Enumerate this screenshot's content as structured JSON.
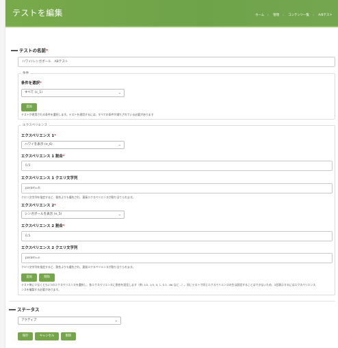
{
  "header": {
    "title": "テストを編集",
    "breadcrumbs": [
      "ホーム",
      "管理",
      "コンテンツ一覧",
      "A/Bテスト"
    ],
    "separator": "›",
    "color": "#74a64c"
  },
  "name_section": {
    "label": "テストの名前",
    "required": "*",
    "value": "ハワイ/シンガポール　ABテスト"
  },
  "conditions": {
    "legend": "条件",
    "select_label": "条件を選択",
    "required": "*",
    "select_value": "すべて (c_1)",
    "add_button": "追加",
    "help": "テストが適用される条件を選択します。テストを適用するには、すべての条件が満たされている必要があります"
  },
  "experiences": {
    "legend": "エクスペリエンス",
    "items": [
      {
        "label": "エクスペリエンス 1",
        "required": "*",
        "select_value": "ハワイを表示 (e_6)",
        "ratio_label": "エクスペリエンス 1 割合",
        "ratio_value": "0.5",
        "query_label": "エクスペリエンス 1 クエリ文字列",
        "query_value": "param=h",
        "query_help": "クエリ文字列を指定すると、割合よりも優先され、直接エクスペリエンスが割り当てられます。"
      },
      {
        "label": "エクスペリエンス 2",
        "required": "*",
        "select_value": "シンガポールを表示 (e_5)",
        "ratio_label": "エクスペリエンス 2 割合",
        "ratio_value": "0.5",
        "query_label": "エクスペリエンス 2 クエリ文字列",
        "query_value": "param=s",
        "query_help": "クエリ文字列を指定すると、割合よりも優先され、直接エクスペリエンスが割り当てられます。"
      }
    ],
    "add_button": "追加",
    "remove_button": "削除",
    "help_line1": "テスト毎に少なくとも2つのエクスペリエンスを選択し、各エクスペリエンスに割合を設定します（例: 1/2, 1/3, 0, 1, 0.5, .66 など...）。同じテストで同じエクスペリエンスの生は設定することはできないため、2回表示するにはエクスペリエンス",
    "help_line2": "ンスを複製する必要があります。"
  },
  "status": {
    "label": "ステータス",
    "value": "アクティブ"
  },
  "actions": {
    "save": "保存",
    "cancel": "キャンセル",
    "delete": "削除"
  },
  "icons": {
    "select_arrow": "chevron-down-icon"
  }
}
